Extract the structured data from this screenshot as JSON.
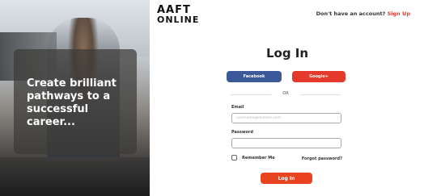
{
  "hero": {
    "tagline": "Create brilliant pathways to a successful career..."
  },
  "brand": {
    "line1": "AAFT",
    "line2": "ONLINE"
  },
  "header": {
    "prompt": "Don't have an account?",
    "signup_link": "Sign Up"
  },
  "form": {
    "title": "Log In",
    "facebook_label": "Facebook",
    "google_label": "Google+",
    "divider": "OR",
    "email_label": "Email",
    "email_placeholder": "username@domain.com",
    "password_label": "Password",
    "password_placeholder": "",
    "remember_label": "Remember Me",
    "forgot_label": "Forgot password?",
    "submit_label": "Log In"
  },
  "colors": {
    "accent": "#e5392b",
    "facebook": "#3b5998",
    "login_button": "#e8441f"
  }
}
